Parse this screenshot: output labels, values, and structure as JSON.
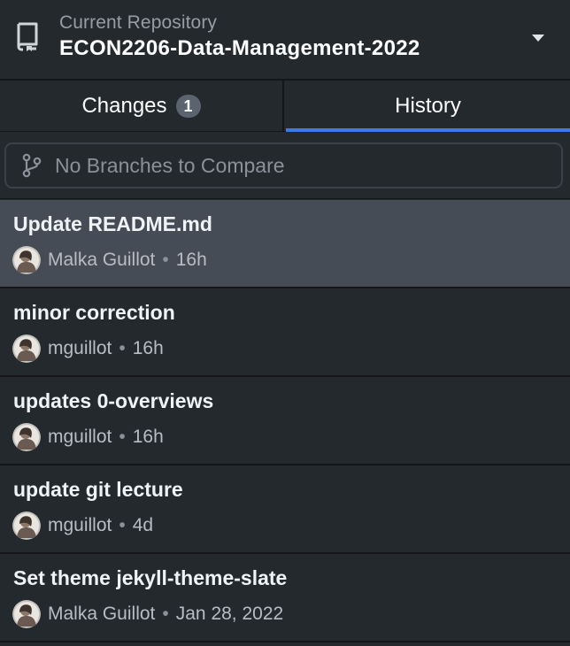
{
  "header": {
    "label": "Current Repository",
    "repo_name": "ECON2206-Data-Management-2022",
    "icons": {
      "repo": "repo-icon",
      "caret": "chevron-down-icon"
    }
  },
  "tabs": {
    "changes_label": "Changes",
    "changes_count": "1",
    "history_label": "History",
    "active": "History",
    "accent_color": "#3b7be8"
  },
  "compare": {
    "placeholder": "No Branches to Compare",
    "icon": "git-branch-icon"
  },
  "commits": [
    {
      "title": "Update README.md",
      "author": "Malka Guillot",
      "time": "16h",
      "selected": true
    },
    {
      "title": "minor correction",
      "author": "mguillot",
      "time": "16h",
      "selected": false
    },
    {
      "title": "updates 0-overviews",
      "author": "mguillot",
      "time": "16h",
      "selected": false
    },
    {
      "title": "update git lecture",
      "author": "mguillot",
      "time": "4d",
      "selected": false
    },
    {
      "title": "Set theme jekyll-theme-slate",
      "author": "Malka Guillot",
      "time": "Jan 28, 2022",
      "selected": false
    }
  ],
  "separator": "•"
}
